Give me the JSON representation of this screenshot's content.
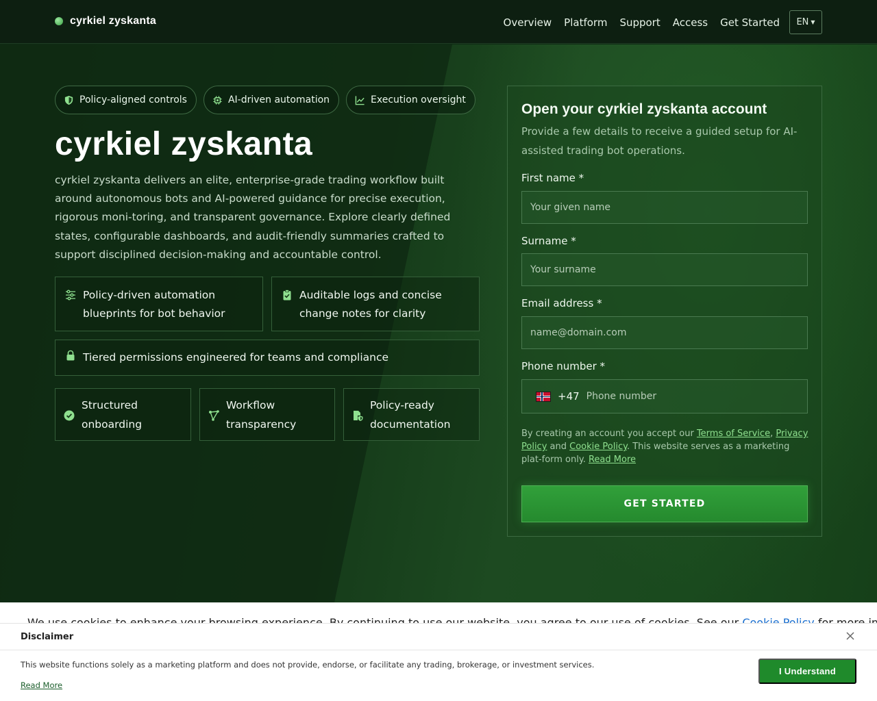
{
  "brand": {
    "name": "cyrkiel zyskanta"
  },
  "nav": {
    "items": [
      "Overview",
      "Platform",
      "Support",
      "Access",
      "Get Started"
    ],
    "language": "EN"
  },
  "hero": {
    "chips": [
      {
        "label": "Policy-aligned controls",
        "icon": "shield-icon"
      },
      {
        "label": "AI-driven automation",
        "icon": "chip-icon"
      },
      {
        "label": "Execution oversight",
        "icon": "line-chart-icon"
      }
    ],
    "title": "cyrkiel zyskanta",
    "description": "cyrkiel zyskanta delivers an elite, enterprise-grade trading workflow built around autonomous bots and AI-powered guidance for precise execution, rigorous moni-toring, and transparent governance. Explore clearly defined states, configurable dashboards, and audit-friendly summaries crafted to support disciplined decision-making and accountable control.",
    "features": [
      {
        "label": "Policy-driven automation blueprints for bot behavior",
        "icon": "sliders-icon"
      },
      {
        "label": "Auditable logs and concise change notes for clarity",
        "icon": "clipboard-check-icon"
      },
      {
        "label": "Tiered permissions engineered for teams and compliance",
        "icon": "lock-icon"
      },
      {
        "label": "Structured onboarding",
        "icon": "check-circle-icon"
      },
      {
        "label": "Workflow transparency",
        "icon": "nodes-icon"
      },
      {
        "label": "Policy-ready documentation",
        "icon": "file-shield-icon"
      }
    ]
  },
  "form": {
    "title": "Open your cyrkiel zyskanta account",
    "subtitle": "Provide a few details to receive a guided setup for AI-assisted trading bot operations.",
    "first_name_label": "First name *",
    "first_name_placeholder": "Your given name",
    "surname_label": "Surname *",
    "surname_placeholder": "Your surname",
    "email_label": "Email address *",
    "email_placeholder": "name@domain.com",
    "phone_label": "Phone number *",
    "phone_dial_code": "+47",
    "phone_placeholder": "Phone number",
    "legal_prefix": "By creating an account you accept our ",
    "terms_link": "Terms of Service",
    "comma": ", ",
    "privacy_link": "Privacy Policy",
    "and": " and ",
    "cookie_link": "Cookie Policy",
    "legal_suffix": ". This website serves as a marketing plat-form only. ",
    "read_more_link": "Read More",
    "submit_label": "GET STARTED"
  },
  "cookie": {
    "text": "We use cookies to enhance your browsing experience. By continuing to use our website, you agree to our use of cookies. See our ",
    "link": "Cookie Policy",
    "suffix": " for more informa"
  },
  "disclaimer": {
    "title": "Disclaimer",
    "text": "This website functions solely as a marketing platform and does not provide, endorse, or facilitate any trading, brokerage, or investment services.",
    "read_more": "Read More",
    "button": "I Understand"
  },
  "colors": {
    "accent": "#258a2e",
    "link": "#8fe08f",
    "background": "#0f2a14"
  }
}
